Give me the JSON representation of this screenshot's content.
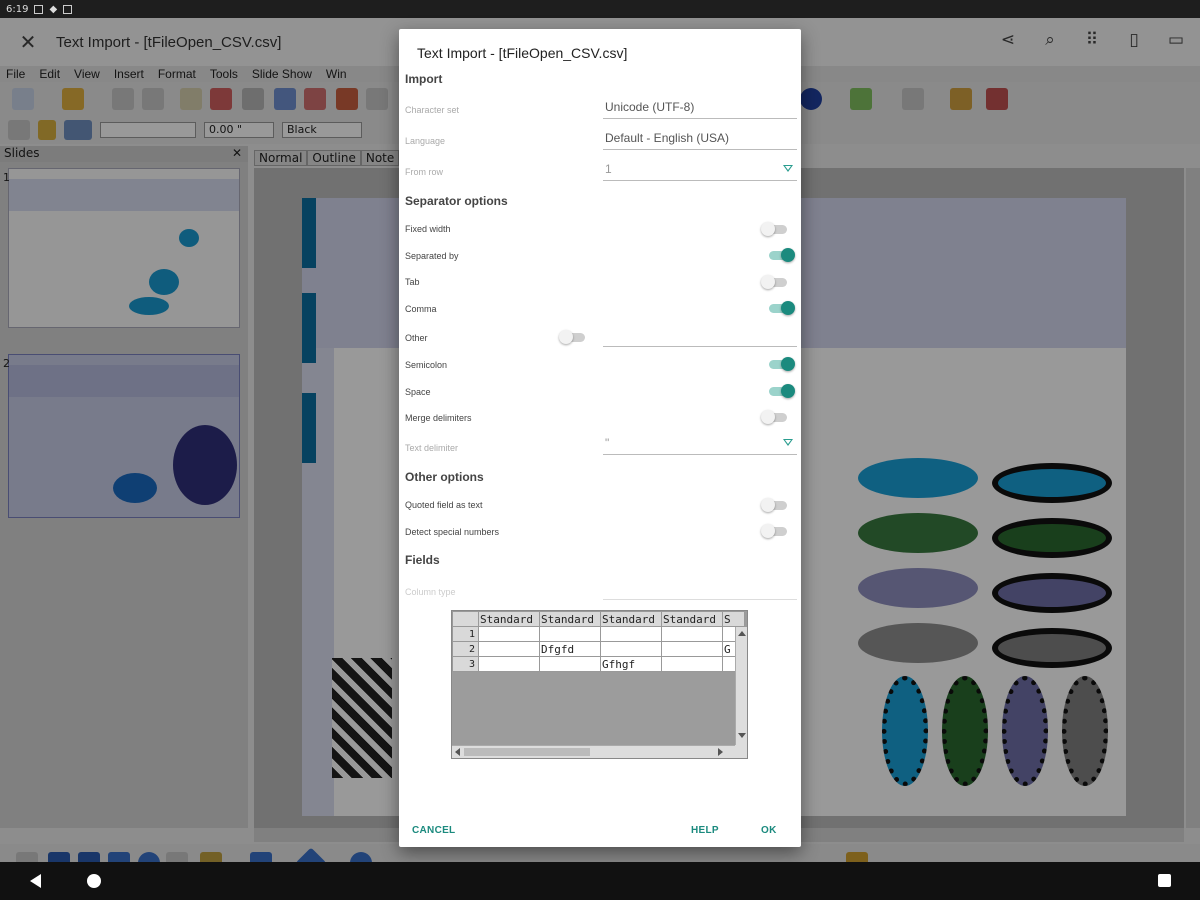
{
  "status": {
    "time": "6:19"
  },
  "app": {
    "title": "Text Import - [tFileOpen_CSV.csv]",
    "menu": [
      "File",
      "Edit",
      "View",
      "Insert",
      "Format",
      "Tools",
      "Slide Show",
      "Win"
    ],
    "line_width": "0.00 \"",
    "line_color": "Black",
    "slides_label": "Slides",
    "slide_numbers": [
      "1",
      "2"
    ],
    "view_tabs": [
      "Normal",
      "Outline",
      "Note"
    ]
  },
  "dialog": {
    "title": "Text Import - [tFileOpen_CSV.csv]",
    "import": {
      "heading": "Import",
      "charset_label": "Character set",
      "charset_value": "Unicode (UTF-8)",
      "language_label": "Language",
      "language_value": "Default - English (USA)",
      "fromrow_label": "From row",
      "fromrow_value": "1"
    },
    "separator": {
      "heading": "Separator options",
      "fixed_width": "Fixed width",
      "separated_by": "Separated by",
      "tab": "Tab",
      "comma": "Comma",
      "other": "Other",
      "semicolon": "Semicolon",
      "space": "Space",
      "merge": "Merge delimiters",
      "text_delimiter_label": "Text delimiter",
      "text_delimiter_value": "\""
    },
    "other": {
      "heading": "Other options",
      "quoted": "Quoted field as text",
      "special": "Detect special numbers"
    },
    "fields": {
      "heading": "Fields",
      "column_type_label": "Column type"
    },
    "preview": {
      "headers": [
        "Standard",
        "Standard",
        "Standard",
        "Standard",
        "S"
      ],
      "rows": [
        {
          "num": "1",
          "cells": [
            "",
            "",
            "",
            "",
            ""
          ]
        },
        {
          "num": "2",
          "cells": [
            "",
            "Dfgfd",
            "",
            "",
            "G"
          ]
        },
        {
          "num": "3",
          "cells": [
            "",
            "",
            "Gfhgf",
            "",
            ""
          ]
        }
      ]
    },
    "buttons": {
      "cancel": "CANCEL",
      "help": "HELP",
      "ok": "OK"
    }
  }
}
